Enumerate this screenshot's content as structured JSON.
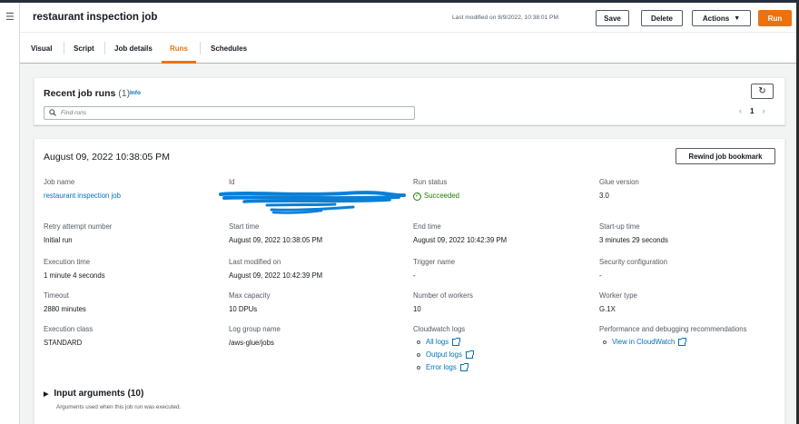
{
  "header": {
    "title": "restaurant inspection job",
    "last_modified": "Last modified on 8/9/2022, 10:38:01 PM",
    "buttons": {
      "save": "Save",
      "delete": "Delete",
      "actions": "Actions",
      "run": "Run"
    }
  },
  "tabs": [
    {
      "label": "Visual",
      "active": false
    },
    {
      "label": "Script",
      "active": false
    },
    {
      "label": "Job details",
      "active": false
    },
    {
      "label": "Runs",
      "active": true
    },
    {
      "label": "Schedules",
      "active": false
    }
  ],
  "recent_runs": {
    "title": "Recent job runs",
    "count": "(1)",
    "info": "Info",
    "search_placeholder": "Find runs",
    "page": "1"
  },
  "run": {
    "date": "August 09, 2022 10:38:05 PM",
    "rewind_button": "Rewind job bookmark",
    "fields": {
      "job_name": {
        "label": "Job name",
        "value": "restaurant inspection job"
      },
      "id": {
        "label": "Id",
        "value": ""
      },
      "run_status": {
        "label": "Run status",
        "value": "Succeeded"
      },
      "glue_version": {
        "label": "Glue version",
        "value": "3.0"
      },
      "retry_attempt": {
        "label": "Retry attempt number",
        "value": "Initial run"
      },
      "start_time": {
        "label": "Start time",
        "value": "August 09, 2022 10:38:05 PM"
      },
      "end_time": {
        "label": "End time",
        "value": "August 09, 2022 10:42:39 PM"
      },
      "startup_time": {
        "label": "Start-up time",
        "value": "3 minutes 29 seconds"
      },
      "execution_time": {
        "label": "Execution time",
        "value": "1 minute 4 seconds"
      },
      "last_modified": {
        "label": "Last modified on",
        "value": "August 09, 2022 10:42:39 PM"
      },
      "trigger_name": {
        "label": "Trigger name",
        "value": "-"
      },
      "security_config": {
        "label": "Security configuration",
        "value": "-"
      },
      "timeout": {
        "label": "Timeout",
        "value": "2880 minutes"
      },
      "max_capacity": {
        "label": "Max capacity",
        "value": "10 DPUs"
      },
      "num_workers": {
        "label": "Number of workers",
        "value": "10"
      },
      "worker_type": {
        "label": "Worker type",
        "value": "G.1X"
      },
      "execution_class": {
        "label": "Execution class",
        "value": "STANDARD"
      },
      "log_group": {
        "label": "Log group name",
        "value": "/aws-glue/jobs"
      },
      "cloudwatch_logs": {
        "label": "Cloudwatch logs",
        "links": [
          "All logs",
          "Output logs",
          "Error logs"
        ]
      },
      "perf_recs": {
        "label": "Performance and debugging recommendations",
        "links": [
          "View in CloudWatch"
        ]
      }
    },
    "input_arguments": {
      "title": "Input arguments (10)",
      "description": "Arguments used when this job run was executed."
    }
  },
  "colors": {
    "accent": "#ec7211",
    "link": "#0073bb",
    "success": "#1d8102",
    "redaction": "#0a7fd6"
  }
}
